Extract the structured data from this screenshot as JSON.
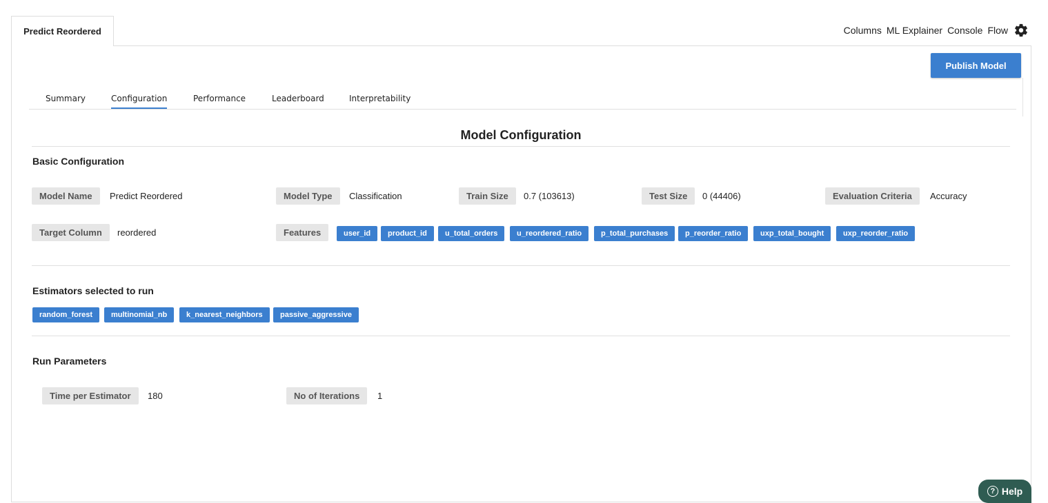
{
  "doc_tab": {
    "label": "Predict Reordered"
  },
  "top_links": [
    "Columns",
    "ML Explainer",
    "Console",
    "Flow"
  ],
  "top_icons": {
    "settings": "gear-icon"
  },
  "publish_label": "Publish Model",
  "subtabs": [
    "Summary",
    "Configuration",
    "Performance",
    "Leaderboard",
    "Interpretability"
  ],
  "active_subtab": "Configuration",
  "section_title": "Model Configuration",
  "basic": {
    "heading": "Basic Configuration",
    "model_name_label": "Model Name",
    "model_name_value": "Predict Reordered",
    "model_type_label": "Model Type",
    "model_type_value": "Classification",
    "train_size_label": "Train Size",
    "train_size_value": "0.7 (103613)",
    "test_size_label": "Test Size",
    "test_size_value": "0 (44406)",
    "eval_label": "Evaluation Criteria",
    "eval_value": "Accuracy",
    "target_label": "Target Column",
    "target_value": "reordered",
    "features_label": "Features",
    "features": [
      "user_id",
      "product_id",
      "u_total_orders",
      "u_reordered_ratio",
      "p_total_purchases",
      "p_reorder_ratio",
      "uxp_total_bought",
      "uxp_reorder_ratio"
    ]
  },
  "estimators": {
    "heading": "Estimators selected to run",
    "items": [
      "random_forest",
      "multinomial_nb",
      "k_nearest_neighbors",
      "passive_aggressive"
    ]
  },
  "run": {
    "heading": "Run Parameters",
    "time_label": "Time per Estimator",
    "time_value": "180",
    "iter_label": "No of Iterations",
    "iter_value": "1"
  },
  "help_label": "Help",
  "help_icon": "question-circle-icon",
  "colors": {
    "accent": "#3b7fcf",
    "help_bg": "#2f5c52",
    "chip_bg": "#e6e6e6"
  }
}
